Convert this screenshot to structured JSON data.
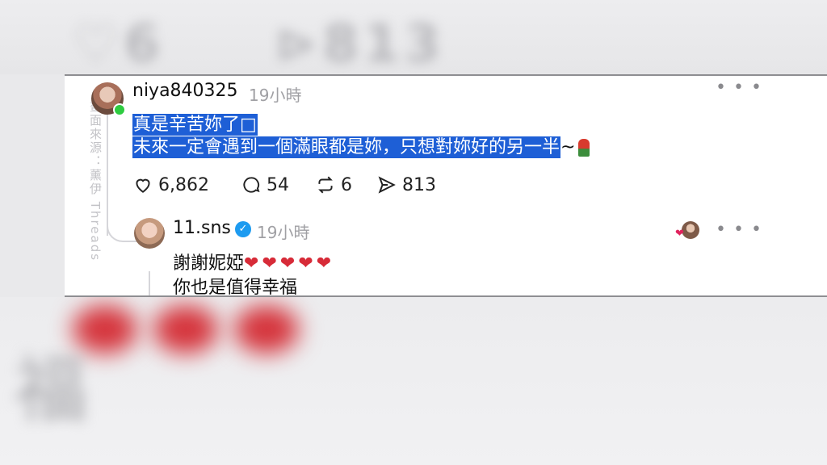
{
  "post": {
    "username": "niya840325",
    "time": "19小時",
    "line1": "真是辛苦妳了",
    "line1_end": "",
    "line2": "未來一定會遇到一個滿眼都是妳，只想對妳好的另一半",
    "line2_suffix": "~",
    "likes": "6,862",
    "comments": "54",
    "reposts": "6",
    "shares": "813"
  },
  "reply": {
    "username": "11.sns",
    "time": "19小時",
    "line1": "謝謝妮婭",
    "hearts": "❤❤❤❤❤",
    "line2": "你也是值得幸福"
  },
  "watermark": "畫面來源：薰伊 Threads",
  "colors": {
    "selection": "#1e5fd6",
    "verified": "#1d9bf0",
    "heart": "#d72b38"
  }
}
